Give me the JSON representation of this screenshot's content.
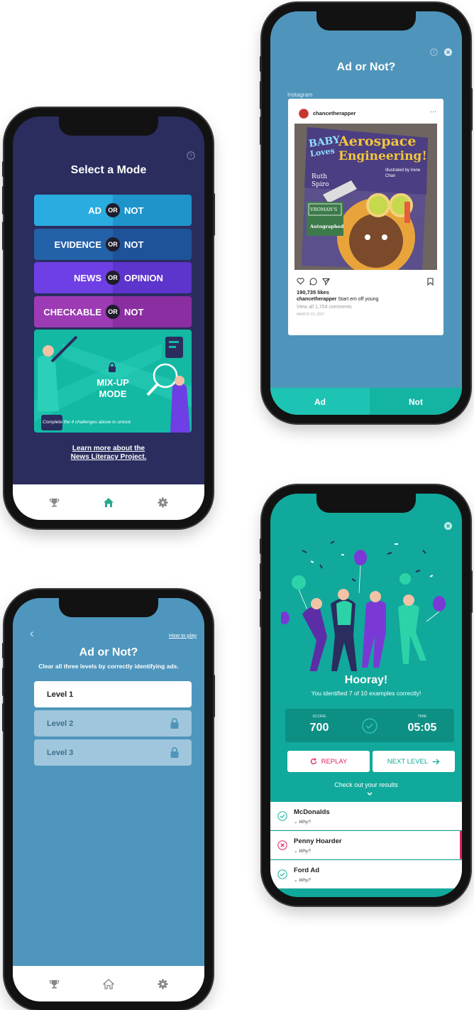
{
  "screen_mode": {
    "title": "Select a Mode",
    "modes": [
      {
        "left": "AD",
        "or": "OR",
        "right": "NOT"
      },
      {
        "left": "EVIDENCE",
        "or": "OR",
        "right": "NOT"
      },
      {
        "left": "NEWS",
        "or": "OR",
        "right": "OPINION"
      },
      {
        "left": "CHECKABLE",
        "or": "OR",
        "right": "NOT"
      }
    ],
    "mixup_title_1": "MIX-UP",
    "mixup_title_2": "MODE",
    "mixup_hint": "Complete the 4 challenges above to unlock",
    "link_line1": "Learn more about the",
    "link_line2": "News Literacy Project.",
    "colors": {
      "bg": "#2a2d5e",
      "ad_left": "#2aace0",
      "ad_right": "#1e94cb",
      "ev_left": "#2361a9",
      "ev_right": "#1e5399",
      "news_left": "#6e3fe4",
      "news_right": "#5d34cc",
      "chk_left": "#9c3bb3",
      "chk_right": "#8a2ea1",
      "mixup": "#14b9a4"
    },
    "icons": [
      "help-icon",
      "lock-icon",
      "trophy-icon",
      "home-icon",
      "gear-icon"
    ]
  },
  "screen_ad": {
    "title": "Ad or Not?",
    "source": "Instagram",
    "username": "chancetherapper",
    "menu": "···",
    "book_title_1": "Aerospace",
    "book_title_2": "Engineering!",
    "book_baby": "BABY",
    "book_loves": "Loves",
    "book_author_1": "Ruth",
    "book_author_2": "Spiro",
    "book_illus": "Illustrated by Irene Chan",
    "book_store": "VROMAN'S",
    "book_autograph": "Autographed",
    "likes": "190,735 likes",
    "caption_user": "chancetherapper",
    "caption_text": " Start em off young",
    "comments": "View all 1,704 comments",
    "date": "MARCH 23, 2017",
    "btn_ad": "Ad",
    "btn_not": "Not",
    "colors": {
      "bg": "#4f95bb",
      "ad_btn": "#1ec4b3",
      "not_btn": "#14b4a3"
    },
    "icons": [
      "help-icon",
      "close-icon",
      "heart-icon",
      "comment-icon",
      "share-icon",
      "bookmark-icon"
    ]
  },
  "screen_levels": {
    "back": "‹",
    "how_to_play": "How to play",
    "title": "Ad or Not?",
    "subtitle": "Clear all three levels by correctly identifying ads.",
    "levels": [
      {
        "label": "Level 1"
      },
      {
        "label": "Level 2"
      },
      {
        "label": "Level 3"
      }
    ],
    "colors": {
      "bg": "#4e96bd",
      "level_active": "#ffffff",
      "level_locked": "#9fc6dc"
    },
    "icons": [
      "back-icon",
      "lock-icon",
      "trophy-icon",
      "home-icon",
      "gear-icon"
    ]
  },
  "screen_result": {
    "title": "Hooray!",
    "subtitle": "You identified 7 of 10 examples correctly!",
    "score_label": "SCORE",
    "score_value": "700",
    "time_label": "TIME",
    "time_value": "05:05",
    "replay": "REPLAY",
    "next_level": "NEXT LEVEL",
    "check_results": "Check out your results",
    "results": [
      {
        "name": "McDonalds",
        "why": "Why?",
        "status": "correct"
      },
      {
        "name": "Penny Hoarder",
        "why": "Why?",
        "status": "incorrect"
      },
      {
        "name": "Ford Ad",
        "why": "Why?",
        "status": "correct"
      }
    ],
    "colors": {
      "bg": "#11a99b",
      "panel": "#0d8f84",
      "correct": "#19b3a0",
      "incorrect": "#e0245e"
    },
    "icons": [
      "close-icon",
      "check-circle-icon",
      "replay-icon",
      "arrow-right-icon",
      "chevron-down-icon",
      "x-circle-icon"
    ]
  }
}
